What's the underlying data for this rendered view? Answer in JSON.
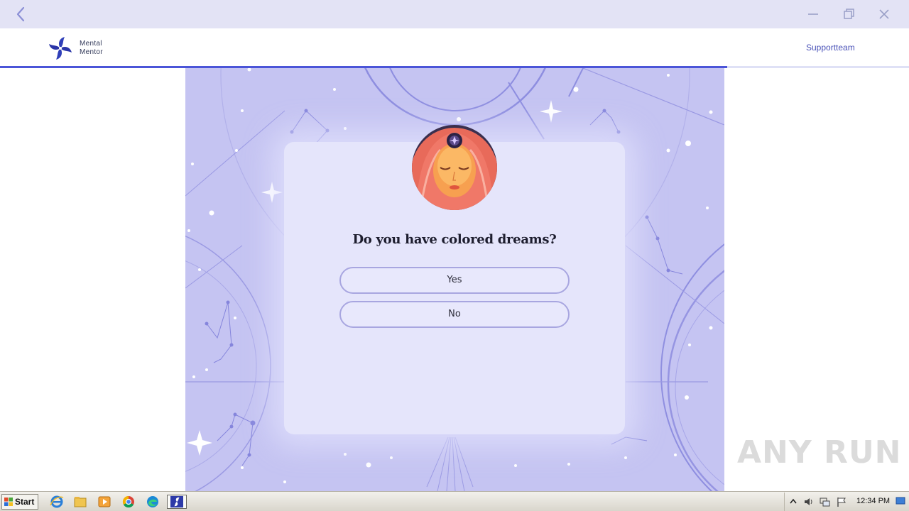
{
  "window": {
    "controls": [
      "back-icon",
      "minimize-icon",
      "restore-icon",
      "close-icon"
    ]
  },
  "header": {
    "brand_line1": "Mental",
    "brand_line2": "Mentor",
    "support_link": "Supportteam",
    "progress_fraction": 0.8
  },
  "quiz": {
    "question": "Do you have colored dreams?",
    "answers": [
      "Yes",
      "No"
    ]
  },
  "watermark": "ANY RUN",
  "taskbar": {
    "start_label": "Start",
    "apps": [
      "internet-explorer-icon",
      "file-explorer-icon",
      "media-player-icon",
      "chrome-icon",
      "edge-icon",
      "mental-mentor-app-icon"
    ],
    "tray": [
      "show-hidden-icons",
      "volume-icon",
      "network-icon",
      "action-center-flag-icon"
    ],
    "clock": "12:34 PM"
  },
  "colors": {
    "accent": "#4b55d8",
    "background_stage": "#c5c4f2",
    "card": "#e5e5fb",
    "button_border": "#a8a6e0"
  }
}
